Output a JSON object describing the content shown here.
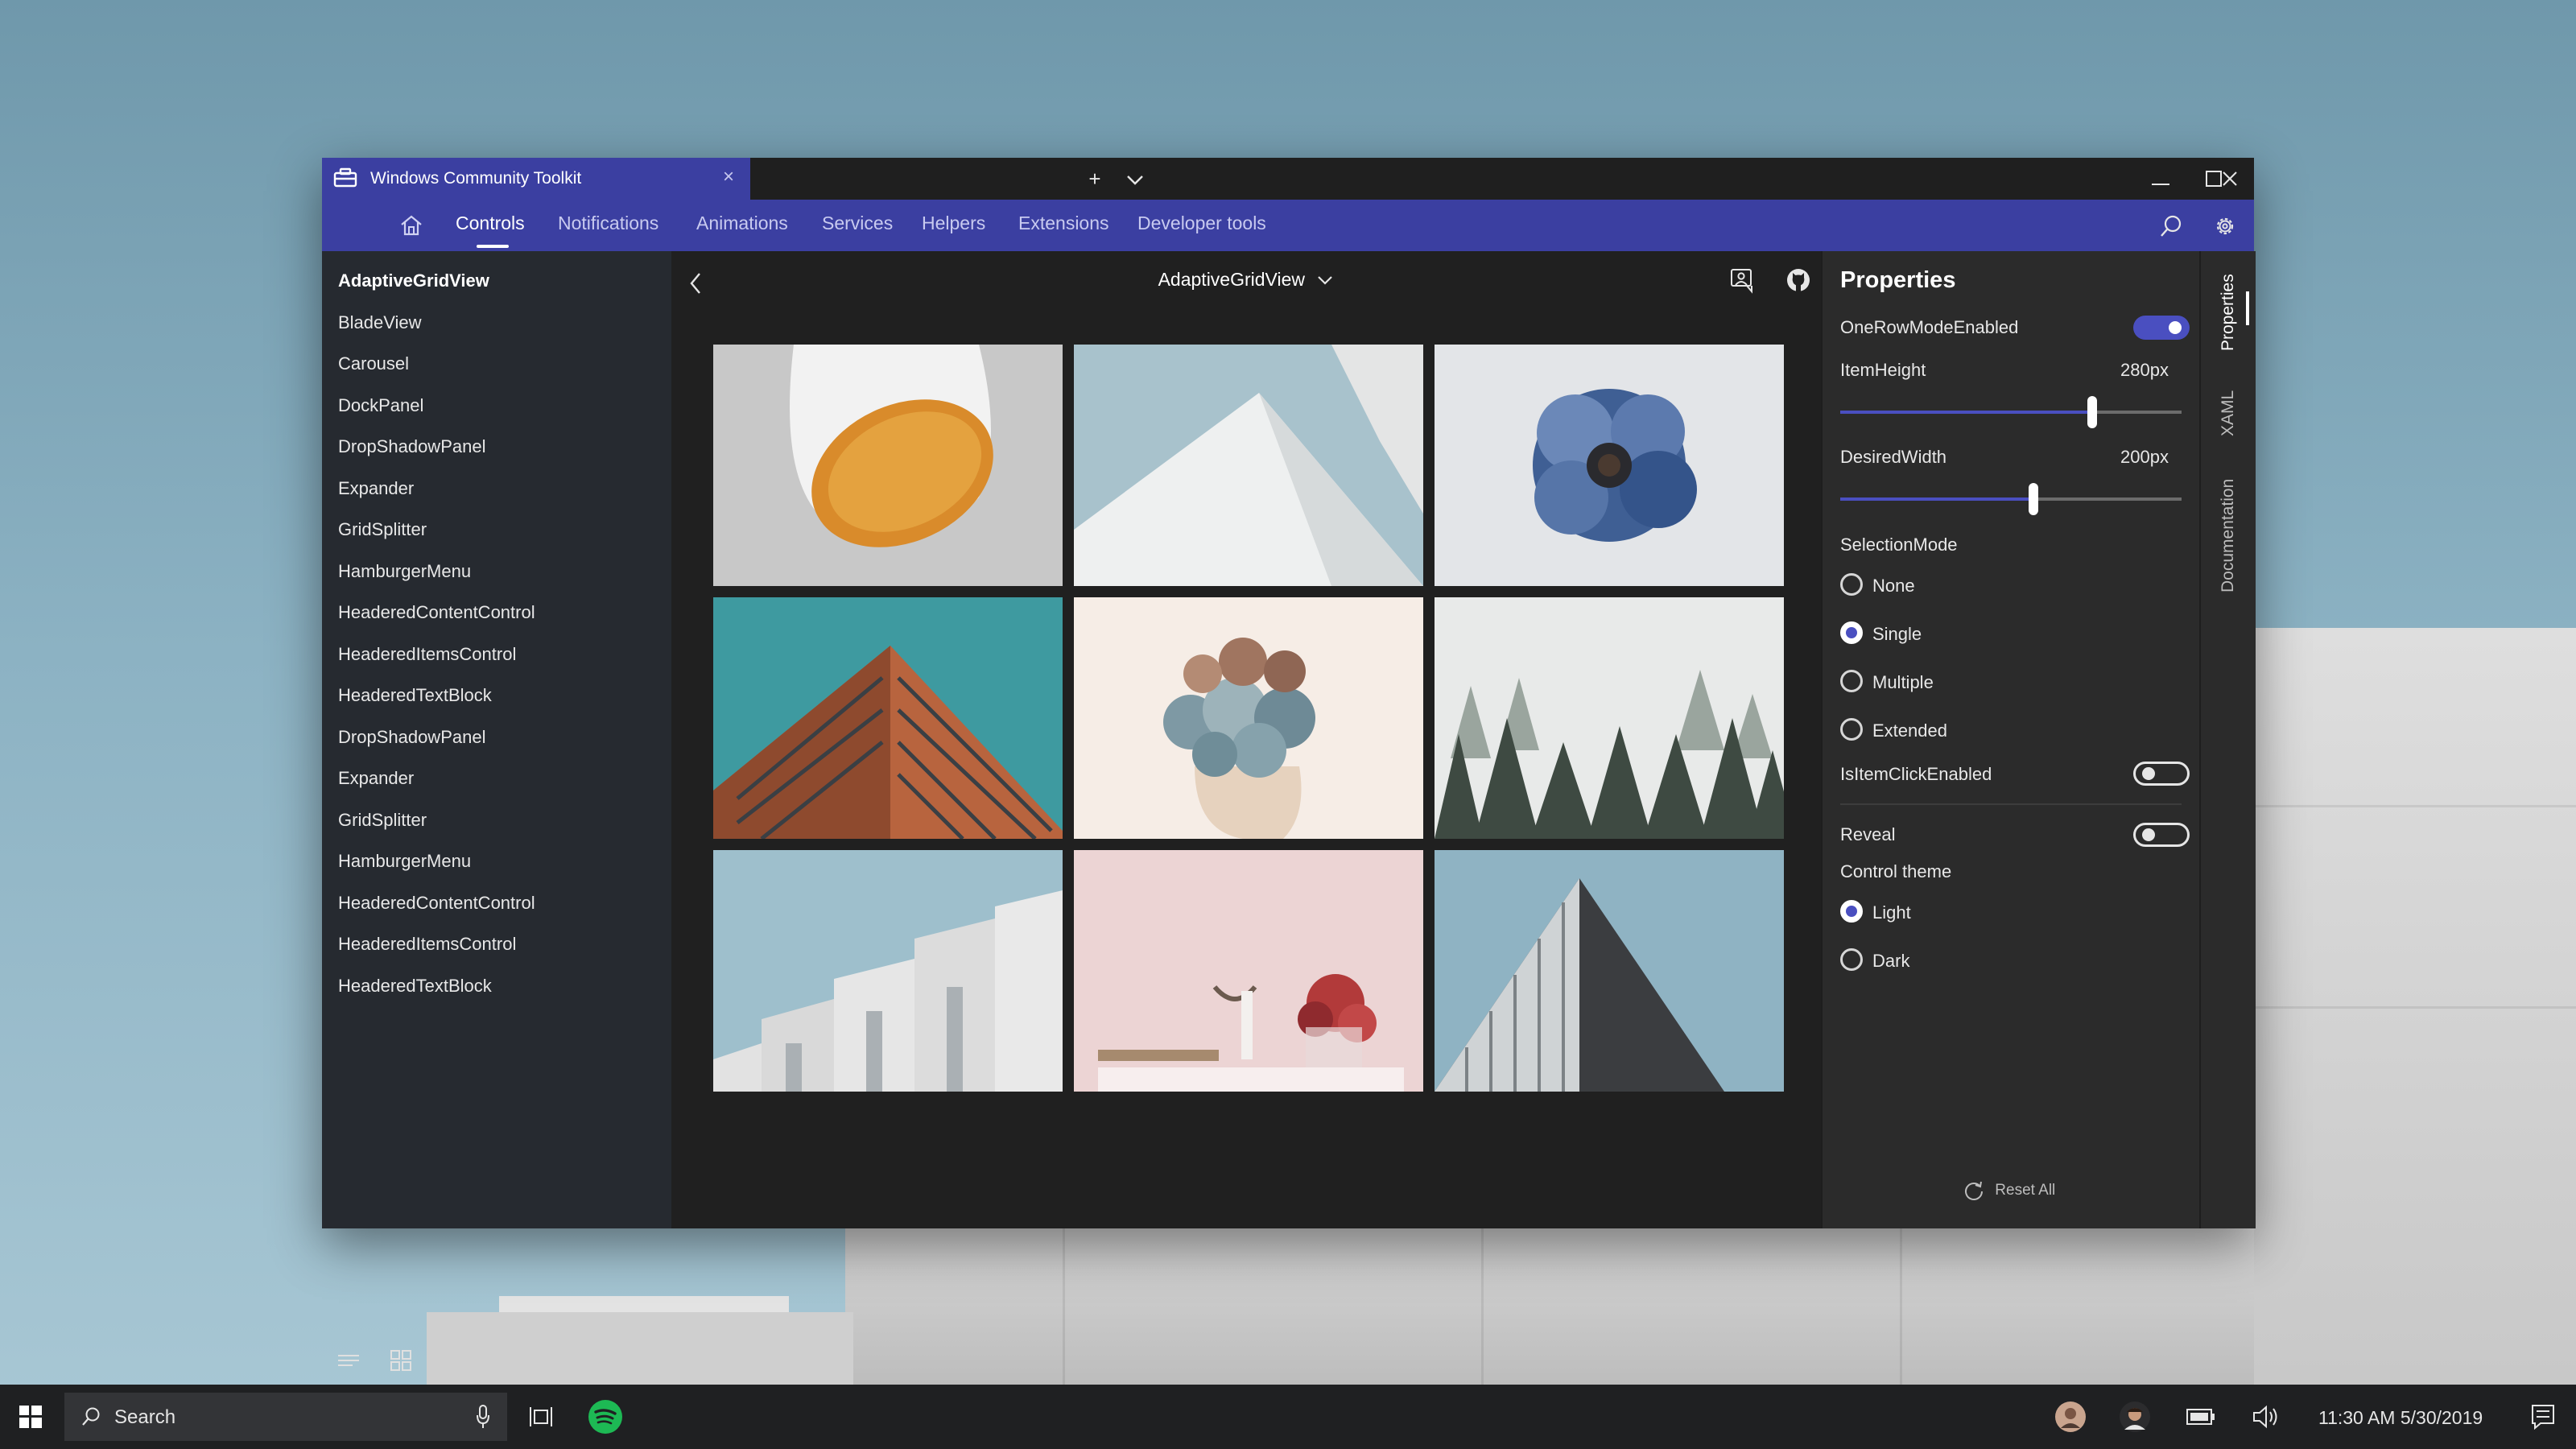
{
  "window": {
    "tab_title": "Windows Community Toolkit",
    "tab_close": "×",
    "new_tab": "+",
    "tab_menu": "⌄",
    "minimize": "—",
    "maximize": "☐",
    "close": "✕",
    "accent_color": "#3b3fa1"
  },
  "nav": {
    "home_icon": "home-icon",
    "items": [
      "Controls",
      "Notifications",
      "Animations",
      "Services",
      "Helpers",
      "Extensions",
      "Developer tools"
    ],
    "active": "Controls"
  },
  "sidebar": {
    "items": [
      "AdaptiveGridView",
      "BladeView",
      "Carousel",
      "DockPanel",
      "DropShadowPanel",
      "Expander",
      "GridSplitter",
      "HamburgerMenu",
      "HeaderedContentControl",
      "HeaderedItemsControl",
      "HeaderedTextBlock",
      "DropShadowPanel",
      "Expander",
      "GridSplitter",
      "HamburgerMenu",
      "HeaderedContentControl",
      "HeaderedItemsControl",
      "HeaderedTextBlock"
    ],
    "active_index": 0
  },
  "main": {
    "title": "AdaptiveGridView",
    "photos": [
      "lamp",
      "white-triangle-building",
      "blue-flower",
      "brick-building",
      "succulents",
      "foggy-forest",
      "white-steps-building",
      "pink-shelf-decor",
      "dark-triangle-building"
    ]
  },
  "properties": {
    "title": "Properties",
    "one_row_mode_label": "OneRowModeEnabled",
    "one_row_mode": true,
    "item_height_label": "ItemHeight",
    "item_height_value": "280px",
    "item_height_fraction": 0.73,
    "desired_width_label": "DesiredWidth",
    "desired_width_value": "200px",
    "desired_width_fraction": 0.56,
    "selection_mode_label": "SelectionMode",
    "selection_modes": [
      "None",
      "Single",
      "Multiple",
      "Extended"
    ],
    "selection_selected": "Single",
    "item_click_label": "IsItemClickEnabled",
    "item_click": false,
    "reveal_label": "Reveal",
    "reveal": false,
    "control_theme_label": "Control theme",
    "themes": [
      "Light",
      "Dark"
    ],
    "theme_selected": "Light",
    "reset_label": "Reset All"
  },
  "vertical_tabs": [
    "Properties",
    "XAML",
    "Documentation"
  ],
  "taskbar": {
    "search_placeholder": "Search",
    "time_date": "11:30 AM 5/30/2019"
  }
}
